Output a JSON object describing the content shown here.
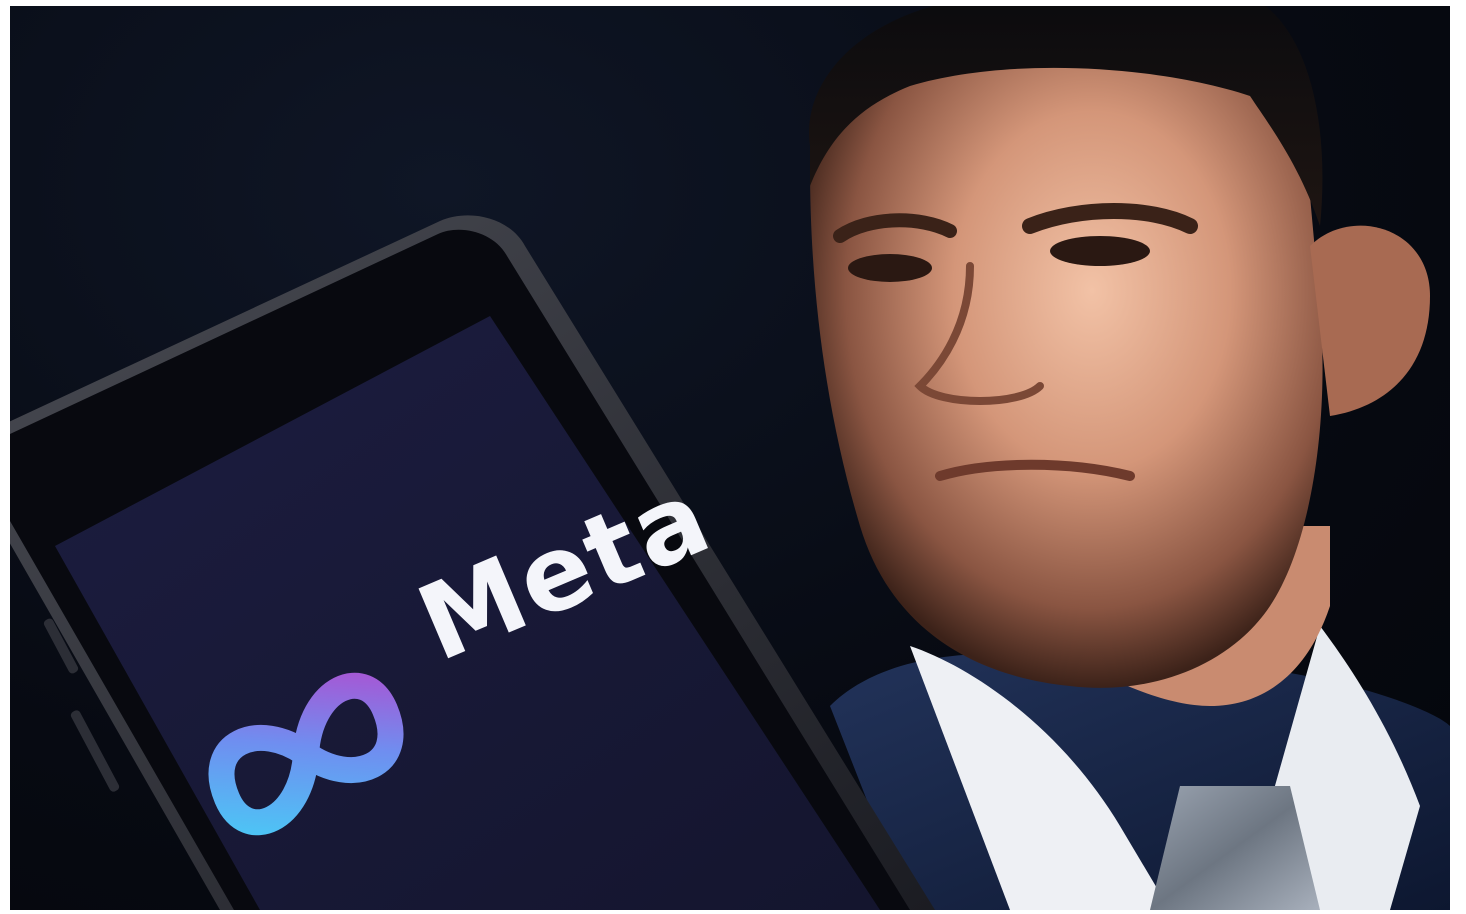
{
  "photo": {
    "description_role": "editorial-photo",
    "brand": {
      "wordmark": "Meta",
      "logo_icon": "meta-infinity-logo-icon"
    },
    "colors": {
      "background": "#070a12",
      "screen": "#1a1a3a",
      "logo_gradient_start": "#4ec3f5",
      "logo_gradient_end": "#a35ad6",
      "wordmark": "#f4f5fa"
    }
  }
}
